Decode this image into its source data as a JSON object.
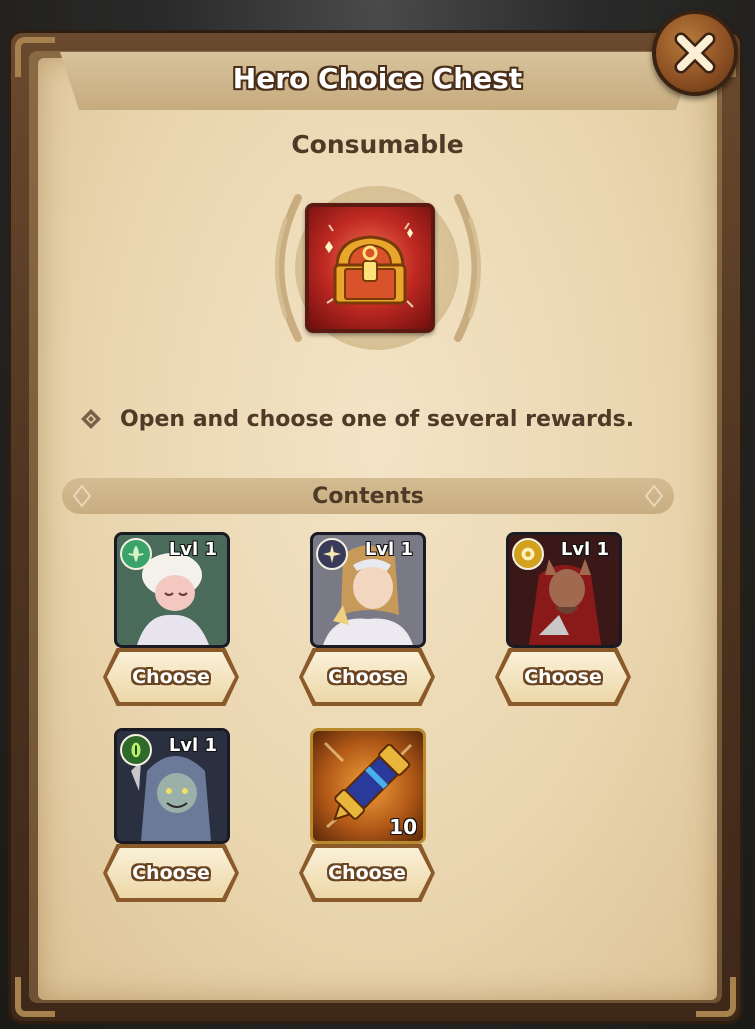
{
  "dialog": {
    "title": "Hero Choice Chest",
    "subtitle": "Consumable",
    "description": "Open and choose one of several rewards.",
    "contents_label": "Contents"
  },
  "item": {
    "icon": "treasure-chest-icon",
    "background_color": "#c02a22"
  },
  "rewards": [
    {
      "type": "hero",
      "faction_icon": "wilder-faction-icon",
      "faction_color": "#3aa36a",
      "level_label": "Lvl 1",
      "button_label": "Choose"
    },
    {
      "type": "hero",
      "faction_icon": "celestial-faction-icon",
      "faction_color": "#3a3a5a",
      "level_label": "Lvl 1",
      "button_label": "Choose"
    },
    {
      "type": "hero",
      "faction_icon": "lightbearer-faction-icon",
      "faction_color": "#d4a020",
      "level_label": "Lvl 1",
      "button_label": "Choose"
    },
    {
      "type": "hero",
      "faction_icon": "graveborn-faction-icon",
      "faction_color": "#2e6a2a",
      "level_label": "Lvl 1",
      "button_label": "Choose"
    },
    {
      "type": "item",
      "icon": "scroll-item-icon",
      "quantity": "10",
      "button_label": "Choose"
    }
  ],
  "colors": {
    "parchment": "#ead6b0",
    "text_brown": "#4e3a26",
    "hero_border": "#7a4ad0",
    "item_border": "#b88a2e"
  }
}
